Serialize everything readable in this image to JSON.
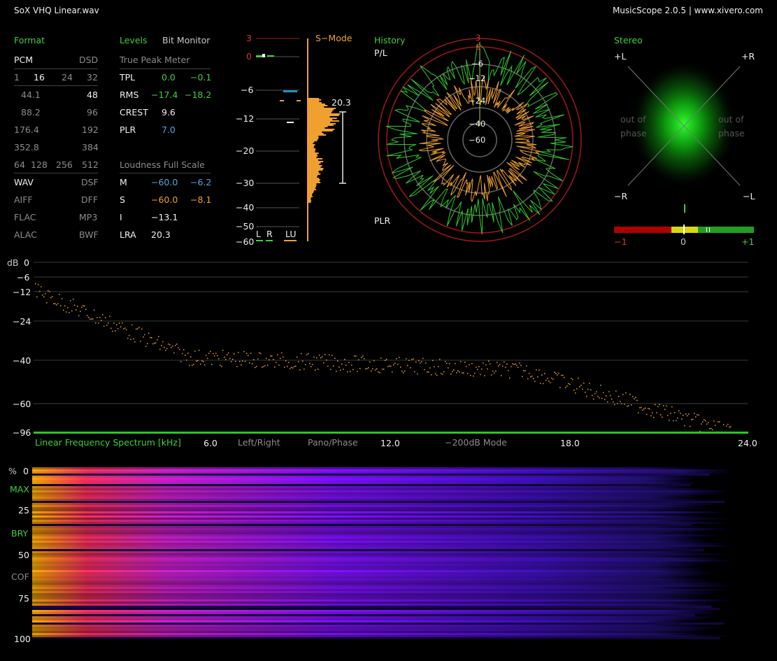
{
  "window": {
    "title": "SoX VHQ Linear.wav",
    "app": "MusicScope 2.0.5 | www.xivero.com"
  },
  "format": {
    "heading": "Format",
    "pcm": "PCM",
    "dsd": "DSD",
    "bits": [
      "1",
      "16",
      "24",
      "32"
    ],
    "rates": [
      [
        "44.1",
        "48"
      ],
      [
        "88.2",
        "96"
      ],
      [
        "176.4",
        "192"
      ],
      [
        "352.8",
        "384"
      ]
    ],
    "dsd_rates": [
      "64",
      "128",
      "256",
      "512"
    ],
    "containers": [
      [
        "WAV",
        "DSF"
      ],
      [
        "AIFF",
        "DFF"
      ],
      [
        "FLAC",
        "MP3"
      ],
      [
        "ALAC",
        "BWF"
      ]
    ]
  },
  "levels": {
    "tab_levels": "Levels",
    "tab_bit_monitor": "Bit Monitor",
    "true_peak_title": "True Peak Meter",
    "rows": [
      {
        "label": "TPL",
        "left": "0.0",
        "right": "−0.1"
      },
      {
        "label": "RMS",
        "left": "−17.4",
        "right": "−18.2"
      },
      {
        "label": "CREST",
        "left": "9.6",
        "right": ""
      },
      {
        "label": "PLR",
        "left": "7.0",
        "right": ""
      }
    ],
    "loudness_title": "Loudness Full Scale",
    "loudness_rows": [
      {
        "label": "M",
        "left": "−60.0",
        "right": "−6.2"
      },
      {
        "label": "S",
        "left": "−60.0",
        "right": "−8.1"
      },
      {
        "label": "I",
        "left": "−13.1",
        "right": ""
      },
      {
        "label": "LRA",
        "left": "20.3",
        "right": ""
      }
    ]
  },
  "meter": {
    "mode": "S−Mode",
    "scale": [
      "3",
      "0",
      "−6",
      "−12",
      "−20",
      "−30",
      "−40",
      "−50",
      "−60"
    ],
    "lra_value": "20.3",
    "channels": [
      "L",
      "R",
      "LU"
    ]
  },
  "history": {
    "heading": "History",
    "top_label": "P/L",
    "bottom_label": "PLR",
    "rings": [
      "3",
      "0",
      "−6",
      "−12",
      "−24",
      "−40",
      "−60"
    ]
  },
  "stereo": {
    "heading": "Stereo",
    "corners": [
      "+L",
      "+R",
      "−R",
      "−L"
    ],
    "out_of_phase": "out of phase",
    "correlation": [
      "−1",
      "0",
      "+1"
    ]
  },
  "spectrum": {
    "title": "Linear Frequency Spectrum [kHz]",
    "db_label": "dB",
    "y_ticks": [
      "0",
      "−6",
      "−12",
      "−24",
      "−40",
      "−60",
      "−96"
    ],
    "x_ticks": [
      "6.0",
      "12.0",
      "18.0",
      "24.0"
    ],
    "buttons": [
      "Left/Right",
      "Pano/Phase",
      "−200dB Mode"
    ]
  },
  "spectrogram": {
    "percent_label": "%",
    "ticks": [
      "0",
      "25",
      "50",
      "75",
      "100"
    ],
    "modes": [
      "MAX",
      "BRY",
      "COF"
    ]
  },
  "colors": {
    "accent_green": "#3fcf3f",
    "accent_orange": "#f0a030",
    "blue": "#4fa8e0",
    "red": "#d02020"
  }
}
